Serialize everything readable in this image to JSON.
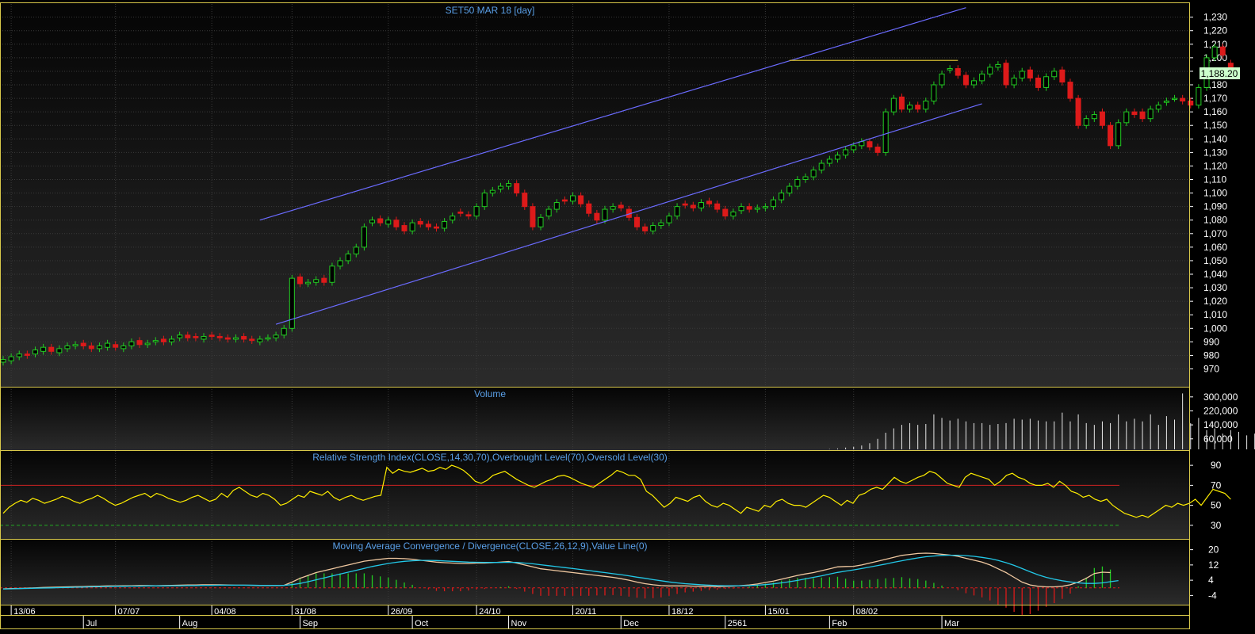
{
  "colors": {
    "background": "#000000",
    "panel_bg_top": "#050505",
    "panel_bg_bottom": "#2b2b2b",
    "frame": "#d8c84a",
    "grid": "#3a3a3a",
    "title_text": "#5aa0e8",
    "axis_text": "#ffffff",
    "bull_candle": "#22cc22",
    "bear_candle": "#dd1a1a",
    "trend_line": "#6b6bff",
    "resistance_line": "#d0b830",
    "price_tag_bg": "#ccffcc",
    "rsi_line": "#ffee00",
    "overbought_line": "#cc2222",
    "oversold_line": "#22aa22",
    "macd_line": "#f0c8a0",
    "signal_line": "#22c8e8",
    "hist_pos": "#22cc22",
    "hist_neg": "#dd1a1a",
    "volume_bar": "#e8e8e8"
  },
  "chart_data": [
    {
      "type": "candlestick",
      "title": "SET50 MAR 18  [day]",
      "ylim": [
        958,
        1238
      ],
      "y_ticks": [
        "1,230",
        "1,220",
        "1,210",
        "1,200",
        "1,190",
        "1,180",
        "1,170",
        "1,160",
        "1,150",
        "1,140",
        "1,130",
        "1,120",
        "1,110",
        "1,100",
        "1,090",
        "1,080",
        "1,070",
        "1,060",
        "1,050",
        "1,040",
        "1,030",
        "1,020",
        "1,010",
        "1,000",
        "990",
        "980",
        "970"
      ],
      "y_tick_values": [
        1230,
        1220,
        1210,
        1200,
        1190,
        1180,
        1170,
        1160,
        1150,
        1140,
        1130,
        1120,
        1110,
        1100,
        1090,
        1080,
        1070,
        1060,
        1050,
        1040,
        1030,
        1020,
        1010,
        1000,
        990,
        980,
        970
      ],
      "last_price_label": "1,188.20",
      "last_price": 1188.2,
      "closes": [
        977,
        979,
        981,
        980,
        984,
        986,
        983,
        985,
        987,
        988,
        987,
        985,
        987,
        989,
        986,
        987,
        990,
        988,
        989,
        991,
        990,
        992,
        995,
        993,
        993,
        994,
        994,
        993,
        992,
        993,
        992,
        991,
        992,
        993,
        995,
        1000,
        1037,
        1033,
        1034,
        1036,
        1034,
        1046,
        1050,
        1055,
        1060,
        1075,
        1080,
        1078,
        1080,
        1075,
        1072,
        1078,
        1077,
        1075,
        1074,
        1079,
        1083,
        1085,
        1083,
        1090,
        1100,
        1102,
        1105,
        1107,
        1100,
        1090,
        1075,
        1082,
        1088,
        1093,
        1094,
        1098,
        1092,
        1085,
        1080,
        1088,
        1090,
        1089,
        1082,
        1075,
        1072,
        1076,
        1078,
        1083,
        1090,
        1091,
        1089,
        1093,
        1092,
        1088,
        1083,
        1086,
        1090,
        1088,
        1089,
        1090,
        1095,
        1100,
        1105,
        1110,
        1112,
        1117,
        1122,
        1125,
        1128,
        1132,
        1135,
        1138,
        1134,
        1130,
        1160,
        1170,
        1162,
        1165,
        1162,
        1168,
        1180,
        1188,
        1192,
        1187,
        1180,
        1183,
        1188,
        1193,
        1195,
        1180,
        1185,
        1190,
        1185,
        1178,
        1186,
        1190,
        1182,
        1170,
        1150,
        1155,
        1158,
        1150,
        1135,
        1152,
        1160,
        1158,
        1155,
        1162,
        1165,
        1168,
        1170,
        1168,
        1165,
        1178,
        1200,
        1208,
        1202,
        1188
      ],
      "opens": [
        975,
        976,
        979,
        981,
        981,
        983,
        986,
        982,
        985,
        987,
        989,
        987,
        985,
        986,
        988,
        985,
        987,
        991,
        988,
        990,
        992,
        990,
        993,
        995,
        994,
        992,
        995,
        994,
        993,
        992,
        994,
        992,
        990,
        993,
        993,
        995,
        1000,
        1038,
        1033,
        1034,
        1037,
        1034,
        1046,
        1050,
        1055,
        1060,
        1078,
        1081,
        1077,
        1080,
        1076,
        1072,
        1079,
        1077,
        1075,
        1074,
        1080,
        1086,
        1084,
        1083,
        1090,
        1100,
        1103,
        1105,
        1107,
        1100,
        1090,
        1075,
        1083,
        1088,
        1095,
        1094,
        1098,
        1092,
        1085,
        1080,
        1088,
        1091,
        1088,
        1082,
        1075,
        1072,
        1076,
        1078,
        1083,
        1092,
        1091,
        1089,
        1094,
        1092,
        1088,
        1083,
        1087,
        1090,
        1088,
        1089,
        1090,
        1095,
        1100,
        1105,
        1110,
        1112,
        1117,
        1122,
        1125,
        1128,
        1132,
        1135,
        1138,
        1134,
        1130,
        1160,
        1171,
        1162,
        1165,
        1162,
        1168,
        1180,
        1191,
        1192,
        1187,
        1180,
        1183,
        1188,
        1193,
        1196,
        1180,
        1185,
        1191,
        1185,
        1178,
        1186,
        1191,
        1182,
        1170,
        1150,
        1155,
        1160,
        1150,
        1135,
        1152,
        1160,
        1160,
        1155,
        1162,
        1167,
        1170,
        1170,
        1168,
        1165,
        1178,
        1200,
        1208,
        1196
      ],
      "volume": {
        "title": "Volume",
        "ylim": [
          0,
          340000
        ],
        "y_ticks": [
          "300,000",
          "220,000",
          "140,000",
          "60,000"
        ],
        "y_tick_values": [
          300000,
          220000,
          140000,
          60000
        ],
        "values": [
          0,
          0,
          0,
          0,
          0,
          0,
          0,
          0,
          0,
          0,
          0,
          0,
          0,
          0,
          0,
          0,
          0,
          0,
          0,
          0,
          0,
          0,
          0,
          0,
          0,
          0,
          0,
          0,
          0,
          0,
          0,
          0,
          0,
          0,
          0,
          0,
          0,
          0,
          0,
          0,
          0,
          0,
          0,
          0,
          0,
          0,
          0,
          0,
          0,
          0,
          0,
          0,
          0,
          0,
          0,
          0,
          0,
          0,
          0,
          0,
          0,
          0,
          0,
          0,
          0,
          0,
          0,
          0,
          0,
          0,
          0,
          0,
          0,
          0,
          0,
          0,
          0,
          0,
          0,
          0,
          0,
          0,
          0,
          0,
          0,
          0,
          0,
          0,
          0,
          0,
          0,
          0,
          0,
          0,
          0,
          0,
          0,
          0,
          0,
          0,
          0,
          0,
          0,
          2000,
          5000,
          10000,
          15000,
          22000,
          35000,
          60000,
          95000,
          120000,
          140000,
          150000,
          140000,
          145000,
          200000,
          180000,
          165000,
          175000,
          160000,
          150000,
          150000,
          140000,
          145000,
          150000,
          175000,
          170000,
          175000,
          165000,
          160000,
          160000,
          210000,
          160000,
          200000,
          150000,
          140000,
          160000,
          150000,
          200000,
          160000,
          175000,
          160000,
          200000,
          140000,
          190000,
          170000,
          320000,
          150000,
          180000,
          110000,
          120000,
          90000,
          110000,
          100000,
          80000,
          90000,
          100000,
          130000,
          170000,
          150000,
          160000,
          220000,
          160000,
          160000
        ]
      },
      "rsi": {
        "title": "Relative Strength Index(CLOSE,14,30,70),Overbought Level(70),Oversold Level(30)",
        "ylim": [
          18,
          102
        ],
        "y_ticks": [
          "90",
          "70",
          "50",
          "30"
        ],
        "y_tick_values": [
          90,
          70,
          50,
          30
        ],
        "overbought": 70,
        "oversold": 30,
        "values": [
          42,
          48,
          52,
          55,
          53,
          57,
          55,
          52,
          54,
          56,
          59,
          57,
          54,
          52,
          55,
          57,
          60,
          57,
          53,
          50,
          52,
          55,
          58,
          60,
          62,
          58,
          62,
          60,
          57,
          55,
          53,
          55,
          58,
          60,
          57,
          54,
          56,
          62,
          58,
          65,
          68,
          64,
          60,
          58,
          62,
          60,
          56,
          50,
          52,
          56,
          60,
          58,
          64,
          62,
          60,
          64,
          58,
          55,
          58,
          60,
          57,
          55,
          57,
          59,
          60,
          88,
          82,
          86,
          84,
          83,
          85,
          87,
          84,
          85,
          88,
          86,
          90,
          88,
          85,
          80,
          74,
          72,
          75,
          80,
          82,
          84,
          80,
          76,
          73,
          70,
          68,
          71,
          74,
          76,
          79,
          80,
          78,
          75,
          72,
          70,
          68,
          72,
          76,
          80,
          85,
          83,
          80,
          80,
          76,
          64,
          60,
          54,
          48,
          52,
          58,
          56,
          54,
          58,
          60,
          54,
          50,
          48,
          52,
          50,
          46,
          42,
          48,
          46,
          44,
          50,
          48,
          54,
          56,
          52,
          50,
          50,
          48,
          52,
          56,
          60,
          58,
          54,
          50,
          55,
          52,
          60,
          62,
          66,
          68,
          66,
          72,
          78,
          74,
          72,
          75,
          78,
          80,
          84,
          82,
          77,
          72,
          70,
          68,
          78,
          82,
          80,
          78,
          76,
          70,
          74,
          80,
          82,
          78,
          76,
          72,
          70,
          70,
          72,
          68,
          74,
          70,
          64,
          62,
          58,
          60,
          56,
          54,
          56,
          50,
          46,
          42,
          40,
          38,
          40,
          38,
          42,
          46,
          50,
          48,
          52,
          50,
          52,
          56,
          50,
          58,
          66,
          64,
          62,
          56
        ]
      },
      "macd": {
        "title": "Moving Average Convergence / Divergence(CLOSE,26,12,9),Value Line(0)",
        "ylim": [
          -8,
          24
        ],
        "y_ticks": [
          "20",
          "12",
          "4",
          "-4"
        ],
        "y_tick_values": [
          20,
          12,
          4,
          -4
        ],
        "value_line": 0,
        "macd": [
          -0.5,
          -0.4,
          -0.3,
          -0.2,
          0,
          0.2,
          0.3,
          0.4,
          0.5,
          0.6,
          0.7,
          0.8,
          0.9,
          1.0,
          1.0,
          1.1,
          1.1,
          1.2,
          1.2,
          1.1,
          1.2,
          1.3,
          1.4,
          1.5,
          1.5,
          1.6,
          1.6,
          1.6,
          1.5,
          1.4,
          1.4,
          1.3,
          1.2,
          1.2,
          1.2,
          1.3,
          3,
          5,
          6.5,
          8,
          9,
          10,
          11,
          12,
          13,
          14,
          14.5,
          15,
          15.5,
          15.5,
          15.3,
          15,
          14.5,
          14,
          13.5,
          13.2,
          13,
          12.8,
          12.8,
          13,
          13,
          13.2,
          13.5,
          13.8,
          13,
          12,
          11,
          10,
          9.5,
          9,
          8.5,
          8,
          7.5,
          7,
          6.5,
          6,
          5.5,
          4.8,
          4,
          3,
          2.2,
          1.6,
          1.2,
          1,
          1,
          1,
          0.9,
          0.8,
          0.8,
          0.7,
          0.8,
          0.9,
          1.2,
          1.5,
          2,
          2.8,
          3.5,
          4.5,
          5.5,
          6.5,
          7.3,
          8,
          9,
          10,
          11,
          11.2,
          11.3,
          12,
          13,
          14,
          15,
          16,
          17,
          17.5,
          18,
          18.2,
          18,
          17.6,
          17.2,
          16.5,
          15.5,
          14.5,
          13.5,
          12,
          10,
          8,
          5.5,
          3,
          1.5,
          0.8,
          0.5,
          0.5,
          0.8,
          1.6,
          3,
          5,
          7.5,
          8.2,
          8
        ],
        "signal": [
          -0.6,
          -0.5,
          -0.4,
          -0.3,
          -0.2,
          -0.1,
          0,
          0.1,
          0.2,
          0.3,
          0.4,
          0.5,
          0.6,
          0.7,
          0.8,
          0.8,
          0.9,
          0.9,
          1.0,
          1.0,
          1.0,
          1.1,
          1.1,
          1.2,
          1.2,
          1.3,
          1.3,
          1.4,
          1.4,
          1.4,
          1.4,
          1.4,
          1.3,
          1.3,
          1.3,
          1.3,
          1.7,
          2.3,
          3.2,
          4.2,
          5.2,
          6.2,
          7.2,
          8.2,
          9.2,
          10.2,
          11.2,
          12,
          12.8,
          13.4,
          13.9,
          14.2,
          14.4,
          14.4,
          14.3,
          14.1,
          13.9,
          13.7,
          13.5,
          13.4,
          13.3,
          13.3,
          13.3,
          13.4,
          13.3,
          13,
          12.6,
          12.1,
          11.6,
          11.1,
          10.6,
          10.1,
          9.6,
          9.1,
          8.5,
          8,
          7.4,
          6.9,
          6.3,
          5.6,
          5,
          4.3,
          3.7,
          3.1,
          2.6,
          2.2,
          1.9,
          1.6,
          1.4,
          1.2,
          1.1,
          1.1,
          1.1,
          1.2,
          1.4,
          1.7,
          2.1,
          2.6,
          3.2,
          3.9,
          4.7,
          5.5,
          6.3,
          7.2,
          8.1,
          8.8,
          9.4,
          10.1,
          10.9,
          11.7,
          12.5,
          13.4,
          14.2,
          15,
          15.7,
          16.3,
          16.7,
          17,
          17.1,
          17.1,
          16.9,
          16.5,
          16,
          15.3,
          14.4,
          13.2,
          11.8,
          10.1,
          8.4,
          6.8,
          5.5,
          4.5,
          3.7,
          3.1,
          2.6,
          2.3,
          2.3,
          2.6,
          3.2,
          3.8
        ]
      },
      "x_ticks_top": [
        {
          "label": "13/06",
          "index": 1
        },
        {
          "label": "07/07",
          "index": 14
        },
        {
          "label": "04/08",
          "index": 26
        },
        {
          "label": "31/08",
          "index": 36
        },
        {
          "label": "26/09",
          "index": 48
        },
        {
          "label": "24/10",
          "index": 59
        },
        {
          "label": "20/11",
          "index": 71
        },
        {
          "label": "18/12",
          "index": 83
        },
        {
          "label": "15/01",
          "index": 95
        },
        {
          "label": "08/02",
          "index": 106
        }
      ],
      "x_ticks_bottom": [
        {
          "label": "Jul",
          "index": 10
        },
        {
          "label": "Aug",
          "index": 22
        },
        {
          "label": "Sep",
          "index": 37
        },
        {
          "label": "Oct",
          "index": 51
        },
        {
          "label": "Nov",
          "index": 63
        },
        {
          "label": "Dec",
          "index": 77
        },
        {
          "label": "2561",
          "index": 90
        },
        {
          "label": "Feb",
          "index": 103
        },
        {
          "label": "Mar",
          "index": 117
        }
      ],
      "annotations": {
        "upper_channel": [
          [
            32,
            1080
          ],
          [
            120,
            1237
          ]
        ],
        "lower_channel": [
          [
            34,
            1003
          ],
          [
            122,
            1166
          ]
        ],
        "resistance": [
          [
            98,
            1198
          ],
          [
            119,
            1198
          ]
        ]
      }
    }
  ]
}
